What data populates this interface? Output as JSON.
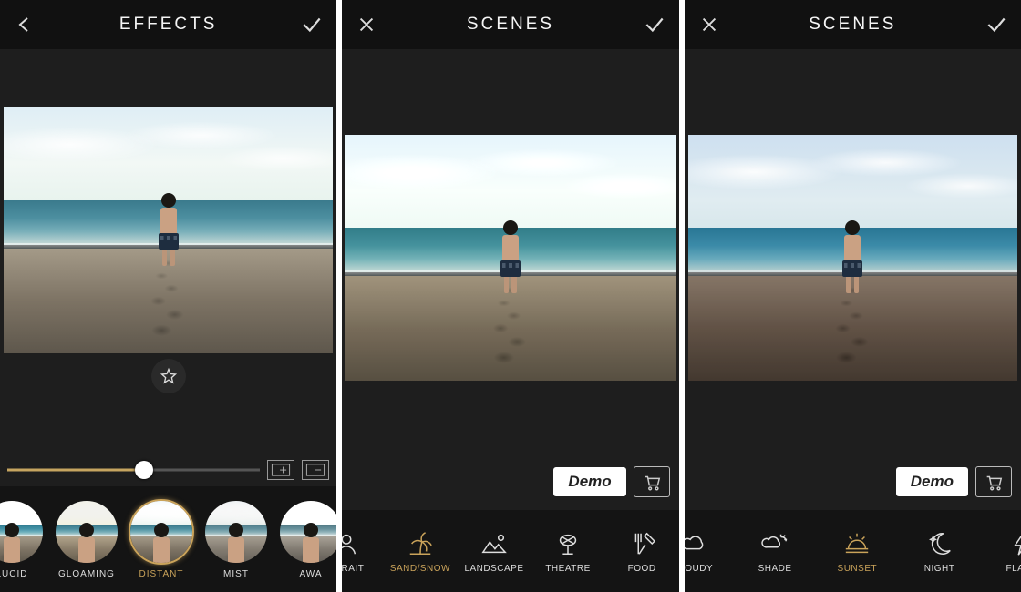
{
  "screens": [
    {
      "header_title": "EFFECTS",
      "left_icon": "back",
      "right_icon": "check",
      "slider_value": 54,
      "effects": [
        {
          "label": "LUCID",
          "active": false
        },
        {
          "label": "GLOAMING",
          "active": false
        },
        {
          "label": "DISTANT",
          "active": true
        },
        {
          "label": "MIST",
          "active": false
        },
        {
          "label": "AWA",
          "active": false
        }
      ]
    },
    {
      "header_title": "SCENES",
      "left_icon": "close",
      "right_icon": "check",
      "demo_label": "Demo",
      "scenes": [
        {
          "label": "RTRAIT",
          "icon": "portrait",
          "active": false
        },
        {
          "label": "SAND/SNOW",
          "icon": "palm",
          "active": true
        },
        {
          "label": "LANDSCAPE",
          "icon": "landscape",
          "active": false
        },
        {
          "label": "THEATRE",
          "icon": "theatre",
          "active": false
        },
        {
          "label": "FOOD",
          "icon": "food",
          "active": false
        }
      ]
    },
    {
      "header_title": "SCENES",
      "left_icon": "close",
      "right_icon": "check",
      "demo_label": "Demo",
      "scenes": [
        {
          "label": "CLOUDY",
          "icon": "cloudy",
          "active": false
        },
        {
          "label": "SHADE",
          "icon": "shade",
          "active": false
        },
        {
          "label": "SUNSET",
          "icon": "sunset",
          "active": true
        },
        {
          "label": "NIGHT",
          "icon": "night",
          "active": false
        },
        {
          "label": "FLASH",
          "icon": "flash",
          "active": false
        }
      ]
    }
  ]
}
